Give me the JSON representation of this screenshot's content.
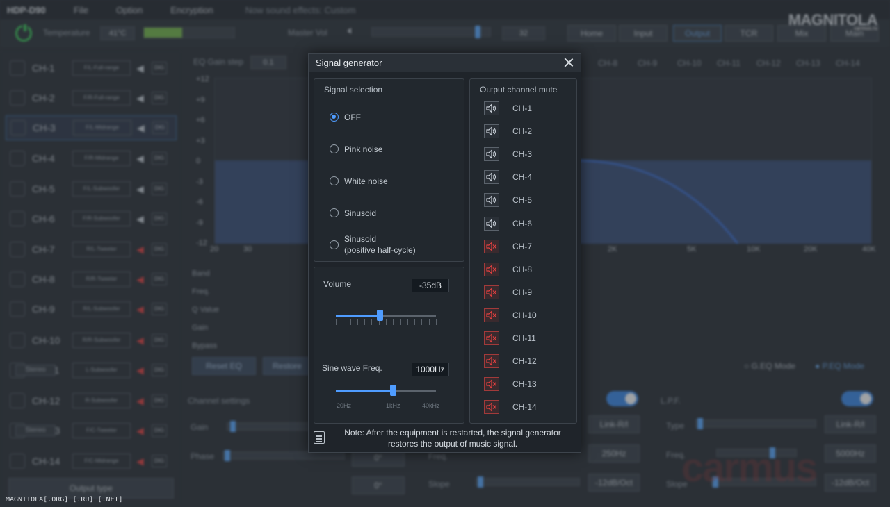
{
  "app": {
    "brand": "HDP-D90",
    "menus": [
      "File",
      "Option",
      "Encryption"
    ],
    "effects_status": "Now sound effects: Custom",
    "logo": "MAGNITOLA",
    "logo_sub": "carmus.ru"
  },
  "topbar": {
    "temperature_label": "Temperature",
    "temperature_value": "41°C",
    "temperature_level": 0.42,
    "master_vol_label": "Master Vol",
    "master_vol_value": "32",
    "nav": [
      "Home",
      "Input",
      "Output",
      "TCR",
      "Mix",
      "Main"
    ],
    "nav_active": "Output"
  },
  "channels": [
    {
      "name": "CH-1",
      "type": "F/L-Full-range",
      "muted": false
    },
    {
      "name": "CH-2",
      "type": "F/R-Full-range",
      "muted": false
    },
    {
      "name": "CH-3",
      "type": "F/L-Midrange",
      "muted": false
    },
    {
      "name": "CH-4",
      "type": "F/R-Midrange",
      "muted": false
    },
    {
      "name": "CH-5",
      "type": "F/L-Subwoofer",
      "muted": false
    },
    {
      "name": "CH-6",
      "type": "F/R-Subwoofer",
      "muted": false
    },
    {
      "name": "CH-7",
      "type": "R/L-Tweeter",
      "muted": true
    },
    {
      "name": "CH-8",
      "type": "R/R-Tweeter",
      "muted": true
    },
    {
      "name": "CH-9",
      "type": "R/L-Subwoofer",
      "muted": true
    },
    {
      "name": "CH-10",
      "type": "R/R-Subwoofer",
      "muted": true
    },
    {
      "name": "CH-11",
      "type": "L-Subwoofer",
      "muted": true
    },
    {
      "name": "CH-12",
      "type": "R-Subwoofer",
      "muted": true
    },
    {
      "name": "CH-13",
      "type": "F/C-Tweeter",
      "muted": true
    },
    {
      "name": "CH-14",
      "type": "F/C-Midrange",
      "muted": true
    }
  ],
  "stereo_label": "Stereo",
  "output_type_label": "Output type",
  "eq": {
    "gain_step_label": "EQ Gain step",
    "gain_step_value": "0.1",
    "y_ticks": [
      "+12",
      "+9",
      "+6",
      "+3",
      "0",
      "-3",
      "-6",
      "-9",
      "-12"
    ],
    "x_ticks": [
      "20",
      "30",
      "2K",
      "5K",
      "10K",
      "20K",
      "40K"
    ],
    "channel_checks": [
      "CH-8",
      "CH-9",
      "CH-10",
      "CH-11",
      "CH-12",
      "CH-13",
      "CH-14"
    ],
    "row_labels": [
      "Band",
      "Freq.",
      "Q Value",
      "Gain",
      "Bypass"
    ],
    "reset_label": "Reset EQ",
    "restore_label": "Restore",
    "geq_label": "G.EQ Mode",
    "peq_label": "P.EQ Mode"
  },
  "bottom": {
    "channel_settings": "Channel settings",
    "gain": "Gain",
    "phase": "Phase",
    "phase_0": "0°",
    "phase_180": "0°",
    "link_rl": "Link-R/l",
    "freq": "Freq.",
    "slope": "Slope",
    "hpf_freq": "250Hz",
    "hpf_slope": "-12dB/Oct",
    "lpf": "L.P.F.",
    "type": "Type",
    "lpf_freq": "5000Hz",
    "lpf_slope": "-12dB/Oct"
  },
  "watermark": "MAGNITOLA[.ORG] [.RU] [.NET]",
  "watermark_car": "carmus",
  "dialog": {
    "title": "Signal generator",
    "signal_selection_title": "Signal selection",
    "signals": [
      "OFF",
      "Pink noise",
      "White noise",
      "Sinusoid",
      "Sinusoid\n(positive half-cycle)"
    ],
    "selected_signal": 0,
    "volume_label": "Volume",
    "volume_value": "-35dB",
    "volume_position": 0.44,
    "freq_label": "Sine wave Freq.",
    "freq_value": "1000Hz",
    "freq_position": 0.57,
    "freq_scale": [
      "20Hz",
      "1kHz",
      "40kHz"
    ],
    "mute_title": "Output channel mute",
    "mute_channels": [
      {
        "name": "CH-1",
        "muted": false
      },
      {
        "name": "CH-2",
        "muted": false
      },
      {
        "name": "CH-3",
        "muted": false
      },
      {
        "name": "CH-4",
        "muted": false
      },
      {
        "name": "CH-5",
        "muted": false
      },
      {
        "name": "CH-6",
        "muted": false
      },
      {
        "name": "CH-7",
        "muted": true
      },
      {
        "name": "CH-8",
        "muted": true
      },
      {
        "name": "CH-9",
        "muted": true
      },
      {
        "name": "CH-10",
        "muted": true
      },
      {
        "name": "CH-11",
        "muted": true
      },
      {
        "name": "CH-12",
        "muted": true
      },
      {
        "name": "CH-13",
        "muted": true
      },
      {
        "name": "CH-14",
        "muted": true
      }
    ],
    "note_line1": "Note: After the equipment is restarted, the signal generator",
    "note_line2": "restores the output of music signal."
  },
  "colors": {
    "accent": "#4f9cff",
    "muted_red": "#e04040",
    "dialog_bg": "#1f242a"
  }
}
